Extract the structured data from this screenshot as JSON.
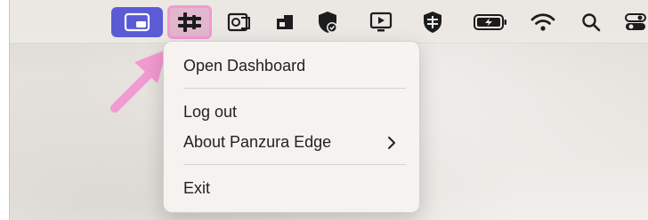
{
  "menubar": {
    "icons": [
      "screen-share-icon",
      "panzura-edge-icon",
      "outlook-icon",
      "cloud-storage-icon",
      "security-shield-icon",
      "remote-display-icon",
      "security-agent-icon",
      "battery-icon",
      "wifi-icon",
      "search-icon",
      "control-center-icon"
    ],
    "active_app_color": "#5b5bd6",
    "highlight_color": "#f29ad1"
  },
  "menu": {
    "open_dashboard": "Open Dashboard",
    "log_out": "Log out",
    "about": "About Panzura Edge",
    "exit": "Exit"
  },
  "annotation": {
    "arrow_color": "#f29ad1"
  }
}
